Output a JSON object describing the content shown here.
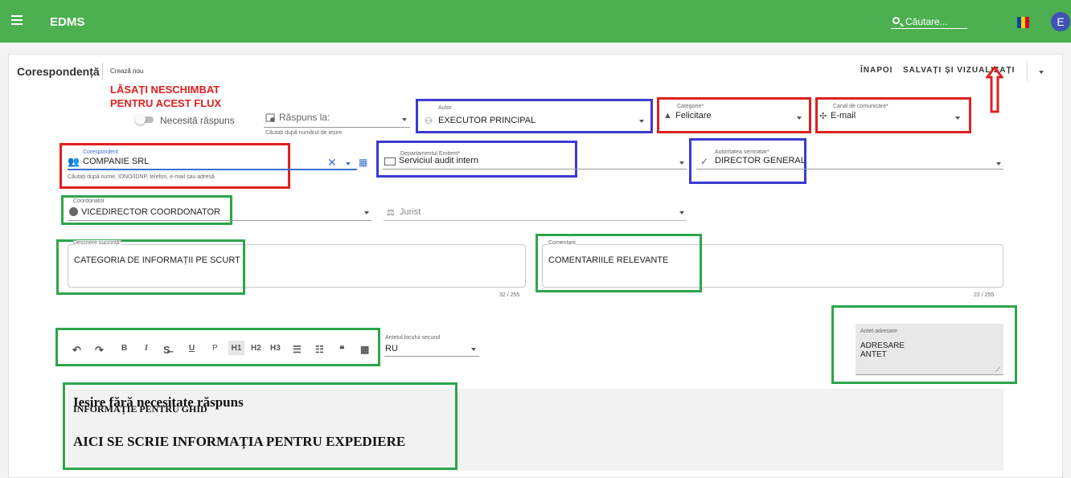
{
  "app": {
    "title": "EDMS",
    "search_placeholder": "Căutare...",
    "avatar_initial": "E",
    "flag_colors": [
      "#0046ae",
      "#ffd200",
      "#cc092f"
    ]
  },
  "page": {
    "title": "Corespondență",
    "breadcrumb": "Crează nou",
    "back_label": "ÎNAPOI",
    "save_view_label": "SALVAȚI ȘI VIZUALIZAȚI"
  },
  "annotation": {
    "line1": "LĂSAȚI NESCHIMBAT",
    "line2": "PENTRU ACEST FLUX",
    "color": "#e02020"
  },
  "form": {
    "requires_response": {
      "label": "Necesită răspuns",
      "checked": false
    },
    "reply_to": {
      "placeholder": "Răspuns la:",
      "hint": "Căutați după numărul de ieșire"
    },
    "author": {
      "label": "Autor",
      "value": "EXECUTOR PRINCIPAL"
    },
    "category": {
      "label": "Categorie*",
      "value": "Felicitare"
    },
    "channel": {
      "label": "Canal de comunicare*",
      "value": "E-mail"
    },
    "correspondent": {
      "label": "Corespondent",
      "value": "COMPANIE SRL",
      "hint": "Căutați după nume, IDNO/IDNP, telefon, e-mail sau adresă"
    },
    "issuing_department": {
      "label": "Departamentul Emitent*",
      "value": "Serviciul audit intern"
    },
    "signing_authority": {
      "label": "Autoritatea semnatar*",
      "value": "DIRECTOR GENERAL"
    },
    "coordinator": {
      "label": "Coordonator",
      "value": "VICEDIRECTOR COORDONATOR"
    },
    "jurist": {
      "placeholder": "Jurist"
    },
    "short_description": {
      "label": "Descriere succintă*",
      "value": "CATEGORIA DE INFORMAȚII PE SCURT",
      "counter": "32 / 255"
    },
    "comments": {
      "label": "Comentarii",
      "value": "COMENTARIILE RELEVANTE",
      "counter": "22 / 255"
    },
    "second_header": {
      "label": "Antetul locului secund",
      "value": "RU"
    },
    "address_header": {
      "label": "Antet adresare",
      "line1": "ADRESARE",
      "line2": "ANTET"
    }
  },
  "toolbar": {
    "bold": "B",
    "italic": "I",
    "underline": "U",
    "paragraph": "P",
    "h1": "H1",
    "h2": "H2",
    "h3": "H3"
  },
  "editor": {
    "heading": "Iesire fără necesitate răspuns",
    "subheading": "INFORMAȚIE PENTRU GHID",
    "body": "AICI SE SCRIE INFORMAȚIA PENTRU EXPEDIERE"
  }
}
